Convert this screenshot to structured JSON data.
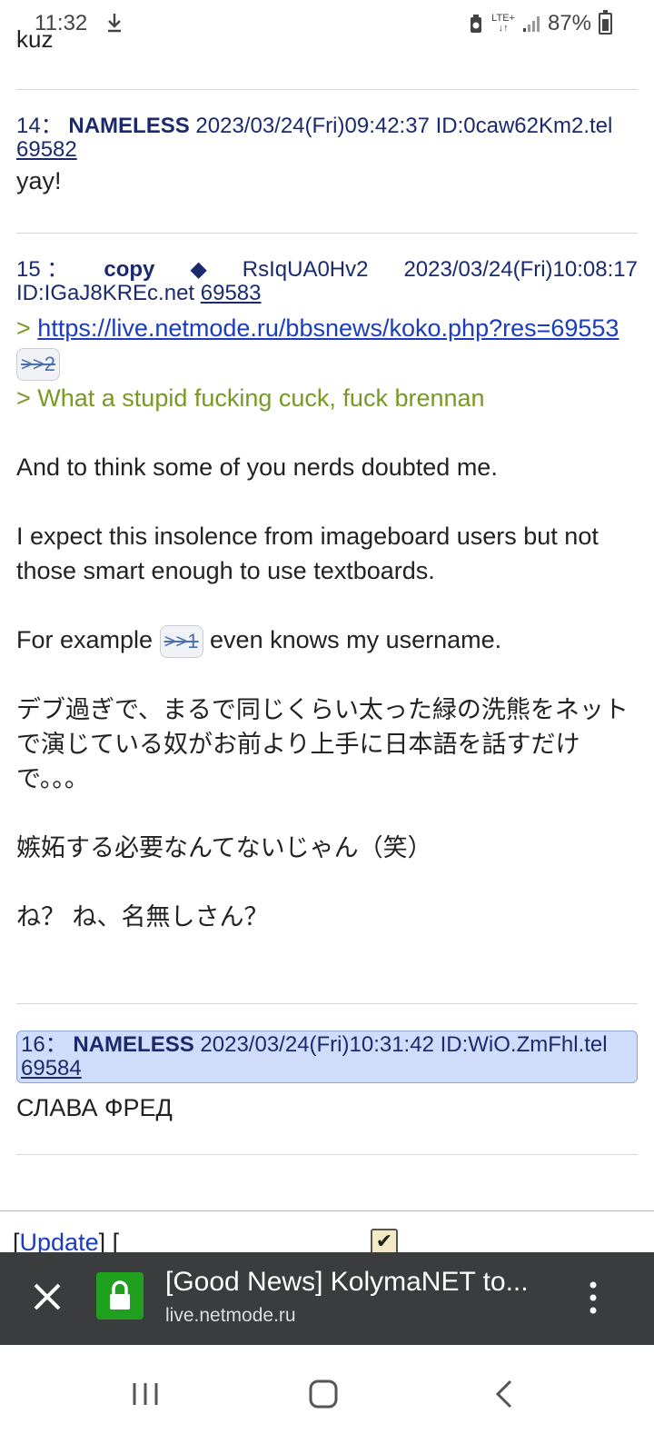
{
  "status_bar": {
    "time": "11:32",
    "network": "LTE+",
    "battery": "87%"
  },
  "prev_cut_text": "kuz",
  "posts": [
    {
      "num": "14：",
      "name": "NAMELESS",
      "datetime": "2023/03/24(Fri)09:42:37",
      "id": "ID:0caw62Km2.tel",
      "link": "69582",
      "body": "yay!"
    },
    {
      "num": "15 ：",
      "name": "copy",
      "trip_mark": "◆",
      "trip": "RsIqUA0Hv2",
      "datetime": "2023/03/24(Fri)10:08:17",
      "id": "ID:IGaJ8KREc.net",
      "link": "69583",
      "quote_url_prefix": ">",
      "quote_url": "https://live.netmode.ru/bbsnews/koko.php?res=69553",
      "quote_ref": ">>2",
      "greentext": "> What a stupid fucking cuck, fuck brennan",
      "para1": "And to think some of you nerds doubted me.",
      "para2": "I expect this insolence from imageboard users but not those smart enough to use textboards.",
      "para3_before": "For example",
      "para3_ref": ">>1",
      "para3_after": "even knows my username.",
      "para4": "デブ過ぎで、まるで同じくらい太った緑の洗熊をネットで演じている奴がお前より上手に日本語を話すだけで。。。",
      "para5": "嫉妬する必要なんてないじゃん（笑）",
      "para6": "ね？ ね、名無しさん？"
    },
    {
      "num": "16：",
      "name": "NAMELESS",
      "datetime": "2023/03/24(Fri)10:31:42",
      "id": "ID:WiO.ZmFhl.tel",
      "link": "69584",
      "body": "СЛАВА ФРЕД"
    }
  ],
  "footer": {
    "update_open": "[",
    "update_label": "Update",
    "update_close": "] ["
  },
  "custom_tab": {
    "title": "[Good News] KolymaNET to...",
    "url": "live.netmode.ru"
  },
  "colors": {
    "header_blue": "#1b2a6e",
    "greentext": "#789922",
    "link_blue": "#1a3cbf",
    "highlight_bg": "#cfdcfa",
    "toolbar_bg": "#3b3c3e",
    "lock_green": "#1fa11f"
  }
}
